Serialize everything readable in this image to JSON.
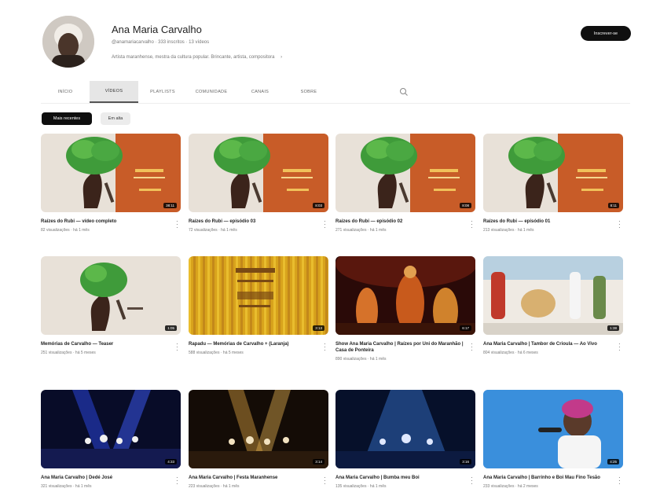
{
  "channel": {
    "name": "Ana Maria Carvalho",
    "meta": "@anamariacarvalho · 333 inscritos · 13 vídeos",
    "description": "Artista maranhense, mestra da cultura popular. Brincante, artista, compositora",
    "subscribe_label": "Inscrever-se"
  },
  "tabs": [
    "INÍCIO",
    "VÍDEOS",
    "PLAYLISTS",
    "COMUNIDADE",
    "CANAIS",
    "SOBRE"
  ],
  "chips": [
    "Mais recentes",
    "Em alta"
  ],
  "videos": [
    {
      "title": "Raízes do Rubi — vídeo completo",
      "meta": "82 visualizações · há 1 mês",
      "duration": "38:11",
      "thumb": "tree-orange"
    },
    {
      "title": "Raízes do Rubi — episódio 03",
      "meta": "72 visualizações · há 1 mês",
      "duration": "8:03",
      "thumb": "tree-orange"
    },
    {
      "title": "Raízes do Rubi — episódio 02",
      "meta": "271 visualizações · há 1 mês",
      "duration": "8:08",
      "thumb": "tree-orange"
    },
    {
      "title": "Raízes do Rubi — episódio 01",
      "meta": "213 visualizações · há 1 mês",
      "duration": "8:11",
      "thumb": "tree-orange"
    },
    {
      "title": "Memórias de Carvalho — Teaser",
      "meta": "251 visualizações · há 5 meses",
      "duration": "1:05",
      "thumb": "tree-beige"
    },
    {
      "title": "Rapadu — Memórias de Carvalho + (Laranja)",
      "meta": "588 visualizações · há 5 meses",
      "duration": "3:13",
      "thumb": "yellow-stripes"
    },
    {
      "title": "Show Ana Maria Carvalho | Raízes por Uni do Maranhão | Casa de Ponteira",
      "meta": "890 visualizações · há 1 mês",
      "duration": "6:17",
      "thumb": "stage-orange"
    },
    {
      "title": "Ana Maria Carvalho | Tambor de Crioula — Ao Vivo",
      "meta": "804 visualizações · há 6 meses",
      "duration": "1:38",
      "thumb": "dance"
    },
    {
      "title": "Ana Maria Carvalho | Dedé José",
      "meta": "321 visualizações · há 1 mês",
      "duration": "4:33",
      "thumb": "stage-blue"
    },
    {
      "title": "Ana Maria Carvalho | Festa Maranhense",
      "meta": "223 visualizações · há 1 mês",
      "duration": "3:14",
      "thumb": "stage-gold"
    },
    {
      "title": "Ana Maria Carvalho | Bumba meu Boi",
      "meta": "135 visualizações · há 1 mês",
      "duration": "3:16",
      "thumb": "stage-blue2"
    },
    {
      "title": "Ana Maria Carvalho | Barrinho e Boi Mau Fino Tesão",
      "meta": "233 visualizações · há 2 meses",
      "duration": "4:25",
      "thumb": "portrait"
    }
  ],
  "colors": {
    "accent": "#0f0f0f",
    "orange_card": "#c85c28",
    "tree_green": "#3f9b3a"
  }
}
